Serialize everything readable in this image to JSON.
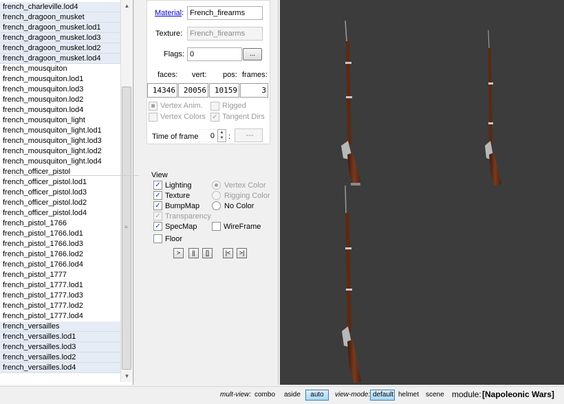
{
  "list": {
    "items": [
      {
        "label": "french_charleville.lod4",
        "selected": true
      },
      {
        "label": "french_dragoon_musket",
        "selected": true
      },
      {
        "label": "french_dragoon_musket.lod1",
        "selected": true
      },
      {
        "label": "french_dragoon_musket.lod3",
        "selected": true
      },
      {
        "label": "french_dragoon_musket.lod2",
        "selected": true
      },
      {
        "label": "french_dragoon_musket.lod4",
        "selected": true
      },
      {
        "label": "french_mousquiton",
        "selected": false
      },
      {
        "label": "french_mousquiton.lod1",
        "selected": false
      },
      {
        "label": "french_mousquiton.lod3",
        "selected": false
      },
      {
        "label": "french_mousquiton.lod2",
        "selected": false
      },
      {
        "label": "french_mousquiton.lod4",
        "selected": false
      },
      {
        "label": "french_mousquiton_light",
        "selected": false
      },
      {
        "label": "french_mousquiton_light.lod1",
        "selected": false
      },
      {
        "label": "french_mousquiton_light.lod3",
        "selected": false
      },
      {
        "label": "french_mousquiton_light.lod2",
        "selected": false
      },
      {
        "label": "french_mousquiton_light.lod4",
        "selected": false
      },
      {
        "label": "french_officer_pistol",
        "selected": false
      },
      {
        "label": "french_officer_pistol.lod1",
        "selected": false
      },
      {
        "label": "french_officer_pistol.lod3",
        "selected": false
      },
      {
        "label": "french_officer_pistol.lod2",
        "selected": false
      },
      {
        "label": "french_officer_pistol.lod4",
        "selected": false
      },
      {
        "label": "french_pistol_1766",
        "selected": false
      },
      {
        "label": "french_pistol_1766.lod1",
        "selected": false
      },
      {
        "label": "french_pistol_1766.lod3",
        "selected": false
      },
      {
        "label": "french_pistol_1766.lod2",
        "selected": false
      },
      {
        "label": "french_pistol_1766.lod4",
        "selected": false
      },
      {
        "label": "french_pistol_1777",
        "selected": false
      },
      {
        "label": "french_pistol_1777.lod1",
        "selected": false
      },
      {
        "label": "french_pistol_1777.lod3",
        "selected": false
      },
      {
        "label": "french_pistol_1777.lod2",
        "selected": false
      },
      {
        "label": "french_pistol_1777.lod4",
        "selected": false
      },
      {
        "label": "french_versailles",
        "selected": true
      },
      {
        "label": "french_versailles.lod1",
        "selected": true
      },
      {
        "label": "french_versailles.lod3",
        "selected": true
      },
      {
        "label": "french_versailles.lod2",
        "selected": true
      },
      {
        "label": "french_versailles.lod4",
        "selected": true
      }
    ]
  },
  "props": {
    "material_label": "Material",
    "material_colon": ":",
    "material_value": "French_firearms",
    "texture_label": "Texture:",
    "texture_value": "French_firearms",
    "flags_label": "Flags:",
    "flags_value": "0",
    "flags_button": "...",
    "stats": {
      "faces_label": "faces:",
      "vert_label": "vert:",
      "pos_label": "pos:",
      "frames_label": "frames:",
      "faces": "14346",
      "vert": "20056",
      "pos": "10159",
      "frames": "3"
    },
    "vertex_anim": "Vertex Anim.",
    "rigged": "Rigged",
    "vertex_colors": "Vertex Colors",
    "tangent_dirs": "Tangent Dirs",
    "time_of_frame_label": "Time of frame",
    "time_of_frame_value": "0",
    "time_colon": ":",
    "frame_name_value": "---"
  },
  "view": {
    "title": "View",
    "lighting": "Lighting",
    "texture": "Texture",
    "bumpmap": "BumpMap",
    "transparency": "Transparency",
    "specmap": "SpecMap",
    "floor": "Floor",
    "vertex_color": "Vertex Color",
    "rigging_color": "Rigging Color",
    "no_color": "No Color",
    "wireframe": "WireFrame",
    "play_buttons": [
      ">",
      "||",
      "[]",
      "|<",
      ">|"
    ]
  },
  "status": {
    "multi_view_label": "mult-view:",
    "combo": "combo",
    "aside": "aside",
    "auto": "auto",
    "view_mode_label": "view-mode:",
    "default": "default",
    "helmet": "helmet",
    "scene": "scene",
    "module_label": "module:",
    "module_value": "[Napoleonic Wars]"
  }
}
